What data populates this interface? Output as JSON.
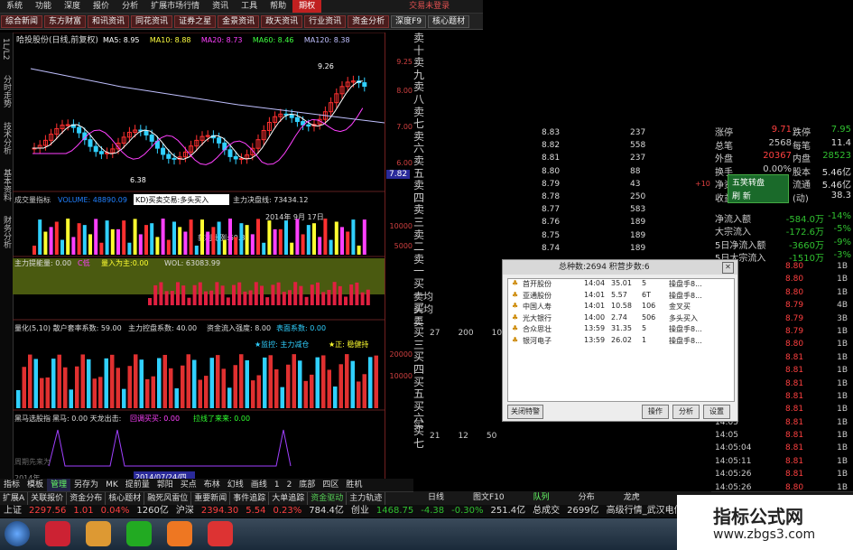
{
  "menu": {
    "items": [
      "系统",
      "功能",
      "深度",
      "报价",
      "分析",
      "扩展市场行情",
      "资讯",
      "工具",
      "帮助"
    ],
    "active": "期权",
    "warn": "交易未登录"
  },
  "tabs": [
    "综合新闻",
    "东方财富",
    "和讯资讯",
    "同花资讯",
    "证券之星",
    "金景资讯",
    "政天资讯",
    "行业资讯",
    "资金分析",
    "深度F9",
    "核心题材"
  ],
  "left_tabs": [
    "1L/L2",
    "分时走势",
    "技术分析",
    "基本资料",
    "财务分析"
  ],
  "chart": {
    "title": "哈投股份(日线,前复权)",
    "ma": [
      {
        "label": "MA5: 8.95",
        "color": "#ffffff"
      },
      {
        "label": "MA10: 8.88",
        "color": "#ffff40"
      },
      {
        "label": "MA20: 8.73",
        "color": "#ff40ff"
      },
      {
        "label": "MA60: 8.46",
        "color": "#40ff40"
      },
      {
        "label": "MA120: 8.38",
        "color": "#c0c0ff"
      }
    ],
    "high_label": "9.26",
    "low_label": "6.38",
    "price_label": "7.82",
    "vol_title": "成交量指标",
    "vol_value": "VOLUME: 48890.09",
    "kd_tip": "KD)买卖交易:多头买入",
    "zl_line": "主力决盘线: 73434.12",
    "date_label": "2014年 9月 17日",
    "profit": "获利比例:60.8",
    "zl_energy": "主力提能量: 0.00",
    "c_label": "C低",
    "vol_prefix": "量入为主:0.00",
    "wol": "WOL: 63083.99",
    "qz_line": "量化(5,10) 散户套率系数: 59.00",
    "qz_2": "主力控盘系数: 40.00",
    "qz_3": "资金流入强度: 8.00",
    "qz_4": "表面系数: 0.00",
    "star1": "★监控: 主力减仓",
    "star2": "★正: 稳健持",
    "hm_title": "黑马选股指",
    "hm_2": "黑马: 0.00 天龙出击:",
    "hm_3": "回调买买: 0.00",
    "hm_4": "拉线了来来: 0.00",
    "hm_bottom": "周期先来为",
    "year_label": "2014年",
    "date2": "2014/07/24/四",
    "axis_vals": [
      "9.25",
      "8.00",
      "7.00",
      "6.00"
    ],
    "axis_vol": [
      "10000",
      "5000"
    ],
    "axis_m": [
      "20000",
      "10000"
    ]
  },
  "orderbook": {
    "sell_labels": [
      "卖十",
      "卖九",
      "卖八",
      "卖七",
      "卖六",
      "卖五",
      "卖四",
      "卖三",
      "卖二",
      "卖一"
    ],
    "buy_labels": [
      "买一",
      "买二",
      "买三",
      "买四",
      "买五",
      "买六",
      "买七"
    ],
    "rows": [
      {
        "p": "8.83",
        "v": "237"
      },
      {
        "p": "8.82",
        "v": "558"
      },
      {
        "p": "8.81",
        "v": "237"
      },
      {
        "p": "8.80",
        "v": "88"
      },
      {
        "p": "8.79",
        "v": "43",
        "mark": "+10"
      },
      {
        "p": "8.78",
        "v": "250"
      },
      {
        "p": "8.77",
        "v": "583"
      },
      {
        "p": "8.76",
        "v": "189"
      },
      {
        "p": "8.75",
        "v": "189"
      },
      {
        "p": "8.74",
        "v": "189"
      }
    ],
    "mid_labels": [
      "卖均",
      "买均",
      "卖"
    ],
    "mid_vals": [
      "27",
      "200",
      "10"
    ],
    "bottom_label": "买",
    "bottom_vals": [
      "21",
      "12",
      "50"
    ]
  },
  "stats": [
    {
      "a": "涨停",
      "b": "9.71",
      "c": "跌停",
      "d": "7.95",
      "bc": "red",
      "dc": "grn"
    },
    {
      "a": "总笔",
      "b": "2568",
      "c": "每笔",
      "d": "11.4",
      "bc": "",
      "dc": ""
    },
    {
      "a": "外盘",
      "b": "20367",
      "c": "内盘",
      "d": "28523",
      "bc": "red",
      "dc": "grn"
    },
    {
      "a": "换手",
      "b": "0.00%",
      "c": "股本",
      "d": "5.46亿",
      "bc": "",
      "dc": ""
    },
    {
      "a": "净资",
      "b": "",
      "c": "流通",
      "d": "5.46亿",
      "bc": "",
      "dc": ""
    },
    {
      "a": "收益(三)",
      "b": "",
      "c": "(动)",
      "d": "38.3",
      "bc": "",
      "dc": ""
    }
  ],
  "popup": {
    "line1": "五笑转盘",
    "line2": "刷 新"
  },
  "flows": [
    {
      "a": "净流入额",
      "b": "-584.0万",
      "c": "-14%"
    },
    {
      "a": "大宗流入",
      "b": "-172.6万",
      "c": "-5%"
    },
    {
      "a": "5日净流入额",
      "b": "-3660万",
      "c": "-9%"
    },
    {
      "a": "5日大宗流入",
      "b": "-1510万",
      "c": "-3%"
    }
  ],
  "ticks": [
    {
      "t": "14:05",
      "p": "8.80",
      "v": "1B"
    },
    {
      "t": "14:05",
      "p": "8.80",
      "v": "1B"
    },
    {
      "t": "14:05",
      "p": "8.80",
      "v": "1B"
    },
    {
      "t": "14:05",
      "p": "8.79",
      "v": "4B"
    },
    {
      "t": "14:05",
      "p": "8.79",
      "v": "3B"
    },
    {
      "t": "14:05",
      "p": "8.79",
      "v": "1B"
    },
    {
      "t": "14:05",
      "p": "8.80",
      "v": "1B"
    },
    {
      "t": "14:05",
      "p": "8.81",
      "v": "1B"
    },
    {
      "t": "14:05",
      "p": "8.81",
      "v": "1B"
    },
    {
      "t": "14:05",
      "p": "8.81",
      "v": "1B"
    },
    {
      "t": "14:05",
      "p": "8.81",
      "v": "1B"
    },
    {
      "t": "14:05",
      "p": "8.81",
      "v": "1B"
    },
    {
      "t": "14:05",
      "p": "8.81",
      "v": "1B"
    },
    {
      "t": "14:05",
      "p": "8.81",
      "v": "1B"
    },
    {
      "t": "14:05:04",
      "p": "8.81",
      "v": "1B"
    },
    {
      "t": "14:05:11",
      "p": "8.81",
      "v": "1B"
    },
    {
      "t": "14:05:26",
      "p": "8.81",
      "v": "1B"
    },
    {
      "t": "14:05:26",
      "p": "8.80",
      "v": "1B"
    },
    {
      "t": "14:05:32",
      "p": "8.81",
      "v": "1B"
    }
  ],
  "dialog": {
    "title": "总种数:2694 积营步数:6",
    "rows": [
      {
        "n": "首开股份",
        "t": "14:04",
        "p": "35.01",
        "v": "5",
        "s": "操盘手8..."
      },
      {
        "n": "亚通股份",
        "t": "14:01",
        "p": "5.57",
        "v": "6T",
        "s": "操盘手8..."
      },
      {
        "n": "中国人寿",
        "t": "14:01",
        "p": "10.58",
        "v": "106",
        "s": "金叉买"
      },
      {
        "n": "光大银行",
        "t": "14:00",
        "p": "2.74",
        "v": "506",
        "s": "多头买入"
      },
      {
        "n": "合众思壮",
        "t": "13:59",
        "p": "31.35",
        "v": "5",
        "s": "操盘手8..."
      },
      {
        "n": "银河电子",
        "t": "13:59",
        "p": "26.02",
        "v": "1",
        "s": "操盘手8..."
      }
    ],
    "btn_close": "关闭特警",
    "btn_op": "操作",
    "btn_an": "分析",
    "btn_set": "设置"
  },
  "bottom_tabs1": [
    "指标",
    "模板",
    "管理",
    "另存为",
    "MK",
    "提前量",
    "郭阳",
    "买点",
    "布林",
    "幻线",
    "画线",
    "1",
    "2",
    "底部",
    "四区",
    "胜机"
  ],
  "bottom_tabs2": [
    "扩展A",
    "关联报价",
    "资金分布",
    "核心题材",
    "融死风雷位",
    "重要新闻",
    "事件追踪",
    "大单追踪",
    "资金驱动",
    "主力轨迹"
  ],
  "right_bottom": [
    "日线",
    "图文F10",
    "队列",
    "分布",
    "龙虎"
  ],
  "status": [
    {
      "t": "上证",
      "c": "#ddd"
    },
    {
      "t": "2297.56",
      "c": "#ff4040"
    },
    {
      "t": "1.01",
      "c": "#ff4040"
    },
    {
      "t": "0.04%",
      "c": "#ff4040"
    },
    {
      "t": "1260亿",
      "c": "#ddd"
    },
    {
      "t": "沪深",
      "c": "#ddd"
    },
    {
      "t": "2394.30",
      "c": "#ff4040"
    },
    {
      "t": "5.54",
      "c": "#ff4040"
    },
    {
      "t": "0.23%",
      "c": "#ff4040"
    },
    {
      "t": "784.4亿",
      "c": "#ddd"
    },
    {
      "t": "创业",
      "c": "#ddd"
    },
    {
      "t": "1468.75",
      "c": "#30c030"
    },
    {
      "t": "-4.38",
      "c": "#30c030"
    },
    {
      "t": "-0.30%",
      "c": "#30c030"
    },
    {
      "t": "251.4亿",
      "c": "#ddd"
    },
    {
      "t": "总成交",
      "c": "#ddd"
    },
    {
      "t": "2699亿",
      "c": "#ddd"
    },
    {
      "t": "高级行情_武汉电信1",
      "c": "#ddd"
    }
  ],
  "brand": {
    "line1": "指标公式网",
    "line2": "www.zbgs3.com"
  }
}
